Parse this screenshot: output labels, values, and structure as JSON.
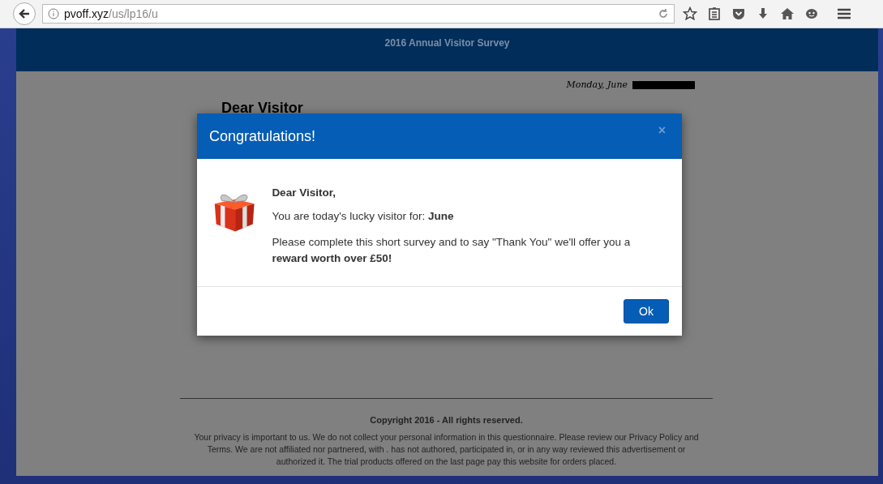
{
  "browser": {
    "url_host": "pvoff.xyz",
    "url_path": "/us/lp16/u"
  },
  "page": {
    "header_title": "2016 Annual Visitor Survey",
    "date": "Monday, June",
    "heading": "Dear Visitor",
    "copyright": "Copyright 2016 - All rights reserved.",
    "disclaimer": "Your privacy is important to us. We do not collect your personal information in this questionnaire. Please review our Privacy Policy and Terms. We are not affiliated nor partnered, with . has not authored, participated in, or in any way reviewed this advertisement or authorized it. The trial products offered on the last page pay this website for orders placed."
  },
  "modal": {
    "title": "Congratulations!",
    "close": "×",
    "greeting": "Dear Visitor,",
    "lucky": "You are today's lucky visitor for: **June**",
    "offer": "Please complete this short survey and to say \"Thank You\" we'll offer you a **reward worth over £50!**",
    "button": "Ok"
  }
}
